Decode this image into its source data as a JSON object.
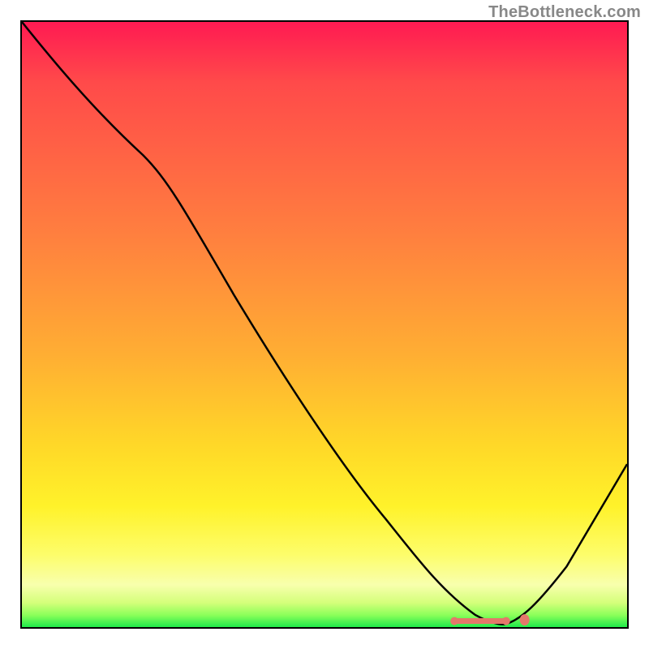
{
  "attribution": "TheBottleneck.com",
  "chart_data": {
    "type": "line",
    "title": "",
    "xlabel": "",
    "ylabel": "",
    "xlim": [
      0,
      100
    ],
    "ylim": [
      0,
      100
    ],
    "curve_points": [
      {
        "x": 0,
        "y": 100
      },
      {
        "x": 10,
        "y": 90
      },
      {
        "x": 20,
        "y": 78
      },
      {
        "x": 25,
        "y": 70
      },
      {
        "x": 35,
        "y": 55
      },
      {
        "x": 50,
        "y": 33
      },
      {
        "x": 60,
        "y": 18
      },
      {
        "x": 70,
        "y": 5
      },
      {
        "x": 75,
        "y": 1
      },
      {
        "x": 80,
        "y": 0.5
      },
      {
        "x": 85,
        "y": 2
      },
      {
        "x": 90,
        "y": 10
      },
      {
        "x": 100,
        "y": 27
      }
    ],
    "marker_line": {
      "x_start": 71,
      "x_end": 80,
      "y": 0.6
    },
    "marker_dot": {
      "x": 83,
      "y": 0.8
    },
    "gradient_colors": {
      "top": "#ff1a52",
      "mid": "#ffd828",
      "bottom": "#1eea4a"
    }
  }
}
